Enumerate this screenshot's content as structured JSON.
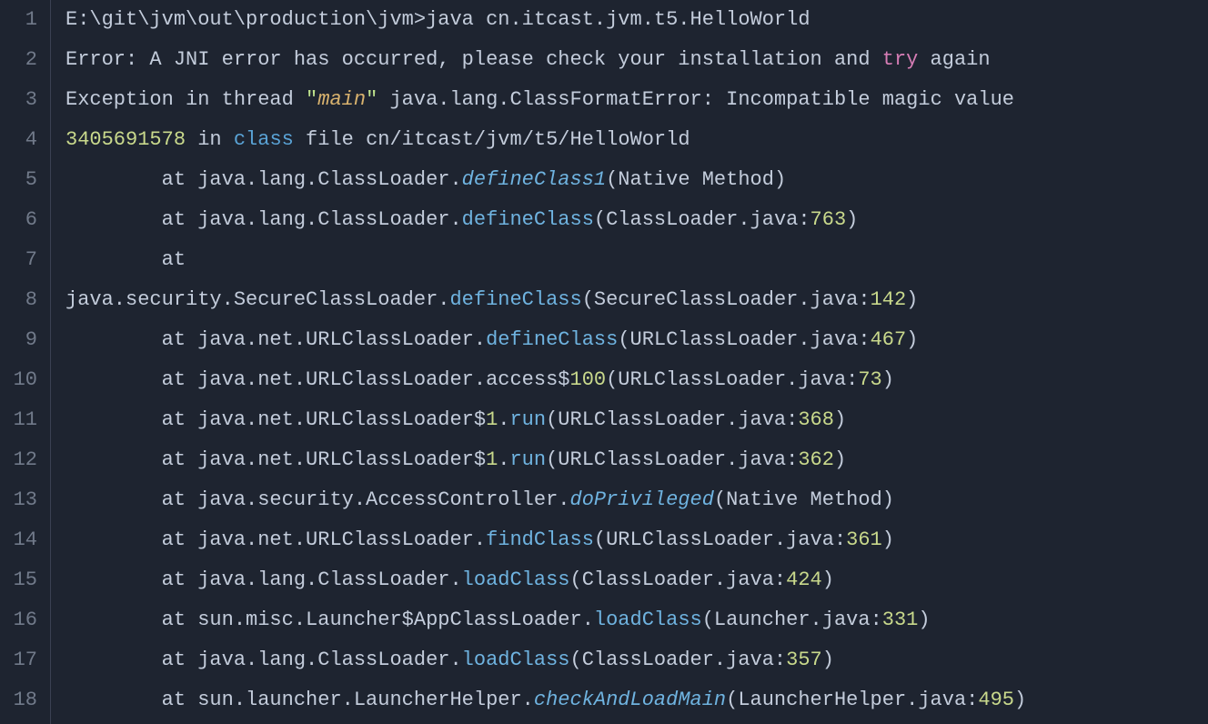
{
  "lineCount": 18,
  "lines": [
    {
      "n": 1,
      "tokens": [
        {
          "cls": "tok-default",
          "t": "E:\\git\\jvm\\out\\production\\jvm>java cn.itcast.jvm.t5.HelloWorld"
        }
      ]
    },
    {
      "n": 2,
      "tokens": [
        {
          "cls": "tok-default",
          "t": "Error: A JNI error has occurred, please check your installation and "
        },
        {
          "cls": "tok-keyword-pink",
          "t": "try"
        },
        {
          "cls": "tok-default",
          "t": " again"
        }
      ]
    },
    {
      "n": 3,
      "tokens": [
        {
          "cls": "tok-default",
          "t": "Exception in thread "
        },
        {
          "cls": "tok-string",
          "t": "\""
        },
        {
          "cls": "tok-param",
          "t": "main"
        },
        {
          "cls": "tok-string",
          "t": "\""
        },
        {
          "cls": "tok-default",
          "t": " java.lang.ClassFormatError: Incompatible magic value"
        }
      ]
    },
    {
      "n": 4,
      "tokens": [
        {
          "cls": "tok-number",
          "t": "3405691578"
        },
        {
          "cls": "tok-default",
          "t": " in "
        },
        {
          "cls": "tok-keyword-blue",
          "t": "class"
        },
        {
          "cls": "tok-default",
          "t": " file cn/itcast/jvm/t5/HelloWorld"
        }
      ]
    },
    {
      "n": 5,
      "tokens": [
        {
          "cls": "tok-default",
          "t": "        at java.lang.ClassLoader."
        },
        {
          "cls": "tok-method-italic",
          "t": "defineClass1"
        },
        {
          "cls": "tok-default",
          "t": "(Native Method)"
        }
      ]
    },
    {
      "n": 6,
      "tokens": [
        {
          "cls": "tok-default",
          "t": "        at java.lang.ClassLoader."
        },
        {
          "cls": "tok-method",
          "t": "defineClass"
        },
        {
          "cls": "tok-default",
          "t": "(ClassLoader.java:"
        },
        {
          "cls": "tok-number",
          "t": "763"
        },
        {
          "cls": "tok-default",
          "t": ")"
        }
      ]
    },
    {
      "n": 7,
      "tokens": [
        {
          "cls": "tok-default",
          "t": "        at"
        }
      ]
    },
    {
      "n": 8,
      "tokens": [
        {
          "cls": "tok-default",
          "t": "java.security.SecureClassLoader."
        },
        {
          "cls": "tok-method",
          "t": "defineClass"
        },
        {
          "cls": "tok-default",
          "t": "(SecureClassLoader.java:"
        },
        {
          "cls": "tok-number",
          "t": "142"
        },
        {
          "cls": "tok-default",
          "t": ")"
        }
      ]
    },
    {
      "n": 9,
      "tokens": [
        {
          "cls": "tok-default",
          "t": "        at java.net.URLClassLoader."
        },
        {
          "cls": "tok-method",
          "t": "defineClass"
        },
        {
          "cls": "tok-default",
          "t": "(URLClassLoader.java:"
        },
        {
          "cls": "tok-number",
          "t": "467"
        },
        {
          "cls": "tok-default",
          "t": ")"
        }
      ]
    },
    {
      "n": 10,
      "tokens": [
        {
          "cls": "tok-default",
          "t": "        at java.net.URLClassLoader.access$"
        },
        {
          "cls": "tok-number",
          "t": "100"
        },
        {
          "cls": "tok-default",
          "t": "(URLClassLoader.java:"
        },
        {
          "cls": "tok-number",
          "t": "73"
        },
        {
          "cls": "tok-default",
          "t": ")"
        }
      ]
    },
    {
      "n": 11,
      "tokens": [
        {
          "cls": "tok-default",
          "t": "        at java.net.URLClassLoader$"
        },
        {
          "cls": "tok-number",
          "t": "1"
        },
        {
          "cls": "tok-default",
          "t": "."
        },
        {
          "cls": "tok-method",
          "t": "run"
        },
        {
          "cls": "tok-default",
          "t": "(URLClassLoader.java:"
        },
        {
          "cls": "tok-number",
          "t": "368"
        },
        {
          "cls": "tok-default",
          "t": ")"
        }
      ]
    },
    {
      "n": 12,
      "tokens": [
        {
          "cls": "tok-default",
          "t": "        at java.net.URLClassLoader$"
        },
        {
          "cls": "tok-number",
          "t": "1"
        },
        {
          "cls": "tok-default",
          "t": "."
        },
        {
          "cls": "tok-method",
          "t": "run"
        },
        {
          "cls": "tok-default",
          "t": "(URLClassLoader.java:"
        },
        {
          "cls": "tok-number",
          "t": "362"
        },
        {
          "cls": "tok-default",
          "t": ")"
        }
      ]
    },
    {
      "n": 13,
      "tokens": [
        {
          "cls": "tok-default",
          "t": "        at java.security.AccessController."
        },
        {
          "cls": "tok-method-italic",
          "t": "doPrivileged"
        },
        {
          "cls": "tok-default",
          "t": "(Native Method)"
        }
      ]
    },
    {
      "n": 14,
      "tokens": [
        {
          "cls": "tok-default",
          "t": "        at java.net.URLClassLoader."
        },
        {
          "cls": "tok-method",
          "t": "findClass"
        },
        {
          "cls": "tok-default",
          "t": "(URLClassLoader.java:"
        },
        {
          "cls": "tok-number",
          "t": "361"
        },
        {
          "cls": "tok-default",
          "t": ")"
        }
      ]
    },
    {
      "n": 15,
      "tokens": [
        {
          "cls": "tok-default",
          "t": "        at java.lang.ClassLoader."
        },
        {
          "cls": "tok-method",
          "t": "loadClass"
        },
        {
          "cls": "tok-default",
          "t": "(ClassLoader.java:"
        },
        {
          "cls": "tok-number",
          "t": "424"
        },
        {
          "cls": "tok-default",
          "t": ")"
        }
      ]
    },
    {
      "n": 16,
      "tokens": [
        {
          "cls": "tok-default",
          "t": "        at sun.misc.Launcher$AppClassLoader."
        },
        {
          "cls": "tok-method",
          "t": "loadClass"
        },
        {
          "cls": "tok-default",
          "t": "(Launcher.java:"
        },
        {
          "cls": "tok-number",
          "t": "331"
        },
        {
          "cls": "tok-default",
          "t": ")"
        }
      ]
    },
    {
      "n": 17,
      "tokens": [
        {
          "cls": "tok-default",
          "t": "        at java.lang.ClassLoader."
        },
        {
          "cls": "tok-method",
          "t": "loadClass"
        },
        {
          "cls": "tok-default",
          "t": "(ClassLoader.java:"
        },
        {
          "cls": "tok-number",
          "t": "357"
        },
        {
          "cls": "tok-default",
          "t": ")"
        }
      ]
    },
    {
      "n": 18,
      "tokens": [
        {
          "cls": "tok-default",
          "t": "        at sun.launcher.LauncherHelper."
        },
        {
          "cls": "tok-method-italic",
          "t": "checkAndLoadMain"
        },
        {
          "cls": "tok-default",
          "t": "(LauncherHelper.java:"
        },
        {
          "cls": "tok-number",
          "t": "495"
        },
        {
          "cls": "tok-default",
          "t": ")"
        }
      ]
    }
  ]
}
